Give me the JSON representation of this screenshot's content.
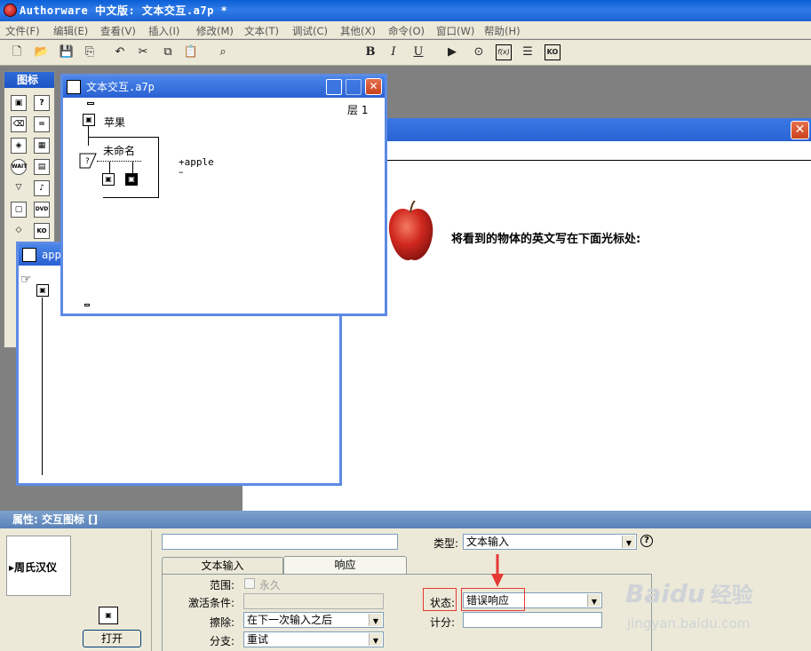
{
  "app": {
    "title": "Authorware 中文版: 文本交互.a7p *"
  },
  "menu": [
    "文件(F)",
    "编辑(E)",
    "查看(V)",
    "插入(I)",
    "修改(M)",
    "文本(T)",
    "调试(C)",
    "其他(X)",
    "命令(O)",
    "窗口(W)",
    "帮助(H)"
  ],
  "toolbar": {
    "bold": "B",
    "italic": "I",
    "underline": "U",
    "fx_label": "f(x)",
    "ko_label": "KO"
  },
  "palette": {
    "title": "图标",
    "icons": [
      "display",
      "decision",
      "erase",
      "map",
      "wait",
      "movie",
      "navigate",
      "calc",
      "framework",
      "sound",
      "digital-movie",
      "knowledge-object"
    ]
  },
  "flow_window": {
    "title": "文本交互.a7p",
    "level": "层 1",
    "nodes": {
      "display_label": "苹果",
      "interaction_label": "未命名"
    },
    "response": {
      "plus": "+",
      "text": "apple",
      "minus": "–"
    }
  },
  "small_window": {
    "title": "app"
  },
  "presentation": {
    "instruction": "将看到的物体的英文写在下面光标处:"
  },
  "properties": {
    "header": "属性: 交互图标 []",
    "preview_text": "▸周氏汉仪",
    "open_button": "打开",
    "name_value": "",
    "type_label": "类型:",
    "type_value": "文本输入",
    "help": "?",
    "tabs": [
      "文本输入",
      "响应"
    ],
    "scope_label": "范围:",
    "scope_value": "永久",
    "activate_label": "激活条件:",
    "activate_value": "",
    "erase_label": "擦除:",
    "erase_value": "在下一次输入之后",
    "branch_label": "分支:",
    "branch_value": "重试",
    "status_label": "状态:",
    "status_value": "错误响应",
    "score_label": "计分:",
    "score_value": ""
  },
  "watermark": {
    "brand": "Baidu",
    "brand_cn": "经验",
    "url": "jingyan.baidu.com"
  },
  "colors": {
    "titlebar": "#1b62d4",
    "annotation": "#e53935",
    "chrome": "#ece9d8"
  }
}
